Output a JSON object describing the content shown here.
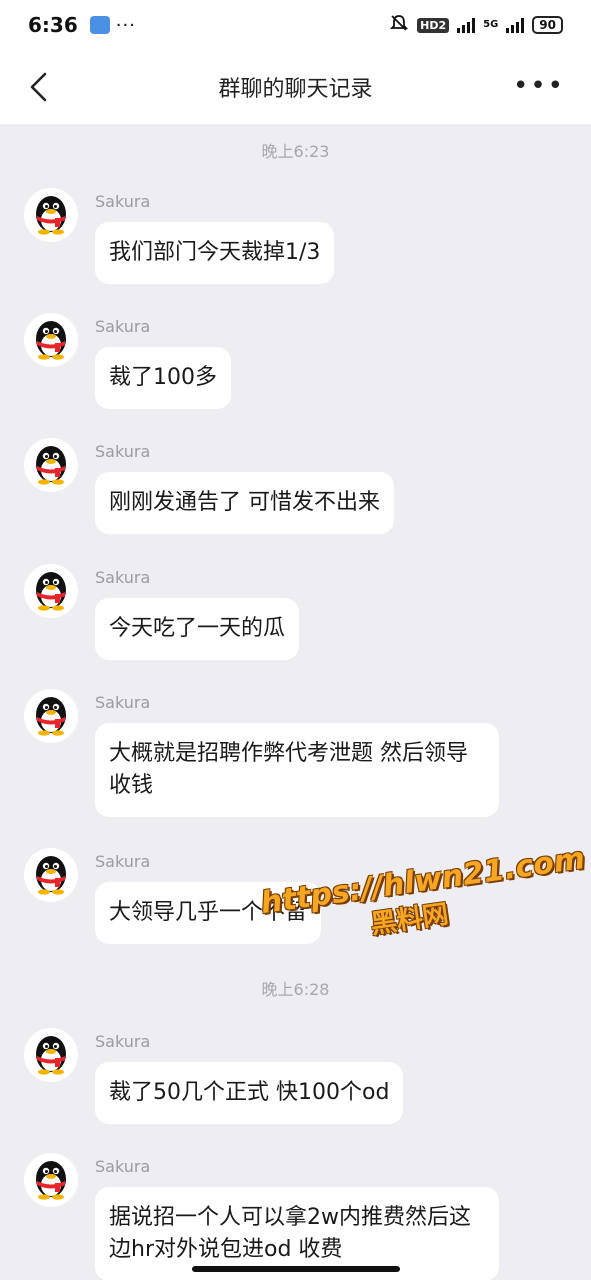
{
  "status_bar": {
    "time": "6:36",
    "dots": "···",
    "hd_label": "HD2",
    "network_label": "5G",
    "battery": "90"
  },
  "nav": {
    "title": "群聊的聊天记录",
    "more": "•••"
  },
  "timestamps": [
    "晚上6:23",
    "晚上6:28"
  ],
  "messages": [
    {
      "sender": "Sakura",
      "text": "我们部门今天裁掉1/3"
    },
    {
      "sender": "Sakura",
      "text": "裁了100多"
    },
    {
      "sender": "Sakura",
      "text": "刚刚发通告了 可惜发不出来"
    },
    {
      "sender": "Sakura",
      "text": "今天吃了一天的瓜"
    },
    {
      "sender": "Sakura",
      "text": "大概就是招聘作弊代考泄题 然后领导收钱"
    },
    {
      "sender": "Sakura",
      "text": "大领导几乎一个不留"
    },
    {
      "sender": "Sakura",
      "text": "裁了50几个正式 快100个od"
    },
    {
      "sender": "Sakura",
      "text": "据说招一个人可以拿2w内推费然后这边hr对外说包进od 收费"
    }
  ],
  "watermark": {
    "line1": "https://hlwn21.com",
    "line2": "黑料网"
  },
  "colors": {
    "background": "#ededf2",
    "bubble": "#ffffff",
    "timestamp": "#a6a6ae",
    "watermark": "#f5a623"
  }
}
